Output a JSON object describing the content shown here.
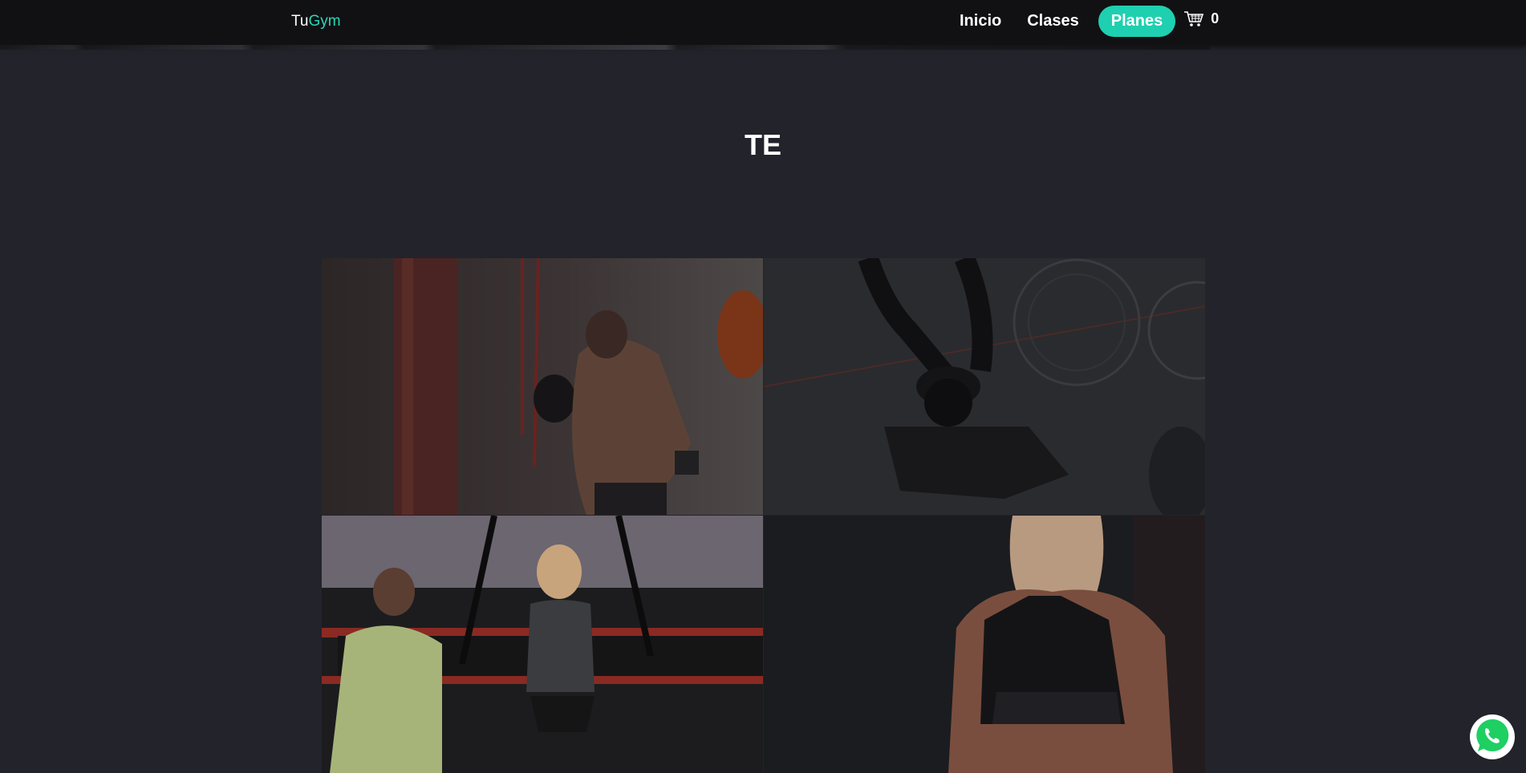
{
  "header": {
    "brand_part1": "Tu",
    "brand_part2": "Gym",
    "nav": [
      {
        "label": "Inicio"
      },
      {
        "label": "Clases"
      },
      {
        "label": "Planes",
        "active": true
      }
    ],
    "cart_icon": "shopping-cart-icon",
    "cart_count": "0"
  },
  "main": {
    "heading": "TE",
    "gallery": [
      {
        "subject": "boxing-bag-photo"
      },
      {
        "subject": "air-bike-photo"
      },
      {
        "subject": "trainer-suspension-training-photo"
      },
      {
        "subject": "athlete-back-photo"
      }
    ]
  },
  "floating": {
    "whatsapp_icon": "whatsapp-icon"
  },
  "colors": {
    "background": "#23232b",
    "navbar": "#111114",
    "accent": "#1ed0b0",
    "brand_accent": "#27d9b6"
  }
}
